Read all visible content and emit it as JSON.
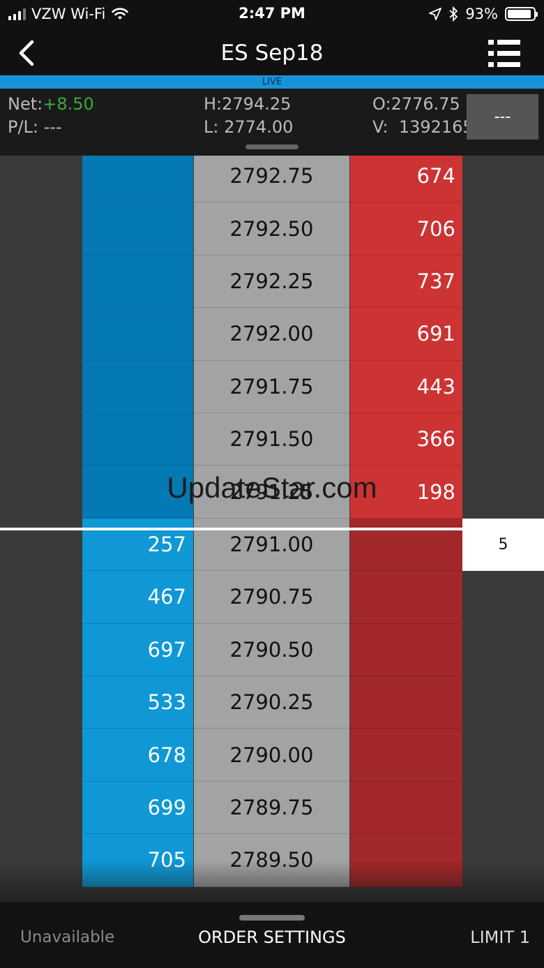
{
  "status_bar": {
    "carrier": "VZW Wi-Fi",
    "time": "2:47 PM",
    "battery_percent": "93%",
    "battery_level": 0.93
  },
  "nav": {
    "title": "ES Sep18",
    "live_label": "LIVE"
  },
  "info": {
    "net_label": "Net:",
    "net_value": "+8.50",
    "pl_label": "P/L:",
    "pl_value": "---",
    "high_label": "H:",
    "high_value": "2794.25",
    "low_label": "L:",
    "low_value": "2774.00",
    "open_label": "O:",
    "open_value": "2776.75",
    "volume_label": "V:",
    "volume_value": "1392165",
    "button_label": "---"
  },
  "ladder": {
    "watermark": "UpdateStar.com",
    "working_order_qty": "5",
    "rows": [
      {
        "price": "2792.75",
        "bid": "",
        "ask": "674"
      },
      {
        "price": "2792.50",
        "bid": "",
        "ask": "706"
      },
      {
        "price": "2792.25",
        "bid": "",
        "ask": "737"
      },
      {
        "price": "2792.00",
        "bid": "",
        "ask": "691"
      },
      {
        "price": "2791.75",
        "bid": "",
        "ask": "443"
      },
      {
        "price": "2791.50",
        "bid": "",
        "ask": "366"
      },
      {
        "price": "2791.25",
        "bid": "",
        "ask": "198"
      },
      {
        "price": "2791.00",
        "bid": "257",
        "ask": ""
      },
      {
        "price": "2790.75",
        "bid": "467",
        "ask": ""
      },
      {
        "price": "2790.50",
        "bid": "697",
        "ask": ""
      },
      {
        "price": "2790.25",
        "bid": "533",
        "ask": ""
      },
      {
        "price": "2790.00",
        "bid": "678",
        "ask": ""
      },
      {
        "price": "2789.75",
        "bid": "699",
        "ask": ""
      },
      {
        "price": "2789.50",
        "bid": "705",
        "ask": ""
      }
    ]
  },
  "bottom": {
    "left_label": "Unavailable",
    "center_label": "ORDER SETTINGS",
    "right_label": "LIMIT 1"
  },
  "colors": {
    "bid_upper": "#0479b3",
    "bid_lower": "#0f98d5",
    "ask_upper": "#cc3333",
    "ask_lower": "#a2282a",
    "price_column": "#a3a3a3",
    "live_bar": "#1893d8",
    "net_positive": "#3ea93e"
  },
  "icons": [
    "signal-icon",
    "wifi-icon",
    "location-icon",
    "bluetooth-icon",
    "battery-icon",
    "back-chevron-icon",
    "list-menu-icon"
  ]
}
